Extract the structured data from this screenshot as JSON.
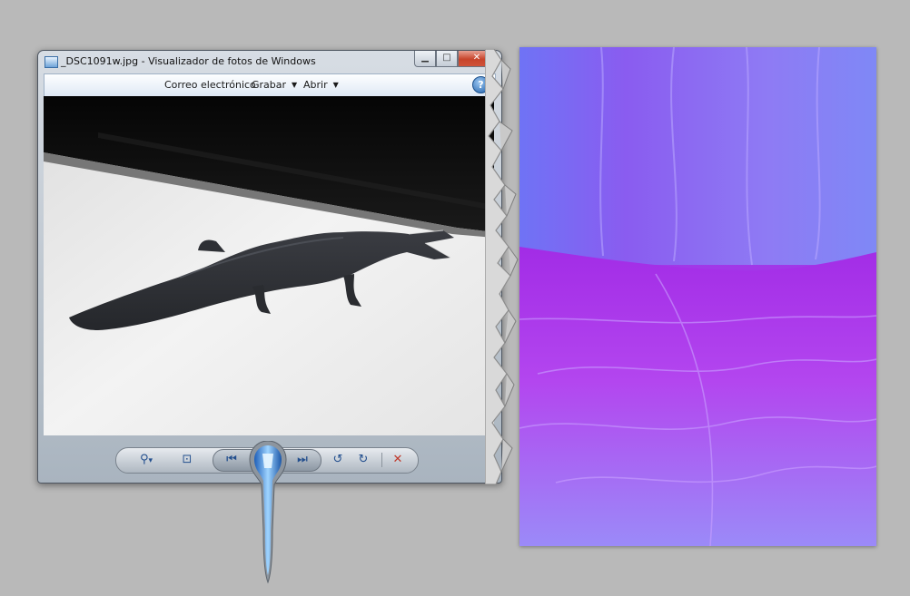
{
  "window": {
    "title": "_DSC1091w.jpg - Visualizador de fotos de Windows",
    "caption_buttons": {
      "minimize": "▁",
      "maximize": "□",
      "close": "✕"
    }
  },
  "menubar": {
    "email_label": "Correo electrónico",
    "burn_label": "Grabar",
    "open_label": "Abrir",
    "dropdown_glyph": "▼",
    "help_glyph": "?"
  },
  "toolbar": {
    "zoom_glyph": "⚲",
    "zoom_arrow": "▾",
    "fit_glyph": "⊡",
    "prev_glyph": "⏮",
    "next_glyph": "⏭",
    "rotate_left_glyph": "↺",
    "rotate_right_glyph": "↻",
    "delete_glyph": "✕"
  },
  "colors": {
    "window_frame": "#a9b4bf",
    "toolbar_icon": "#234f8e",
    "delete_icon": "#c0392b",
    "close_button": "#c7442b",
    "fabric_purple": "#a336e8"
  },
  "icons": {
    "app": "photo-viewer-icon",
    "help": "help-icon",
    "zoom": "magnifier-icon",
    "fit": "fit-window-icon",
    "prev": "previous-icon",
    "slideshow": "slideshow-icon",
    "next": "next-icon",
    "rotate_left": "rotate-left-icon",
    "rotate_right": "rotate-right-icon",
    "delete": "delete-icon"
  }
}
